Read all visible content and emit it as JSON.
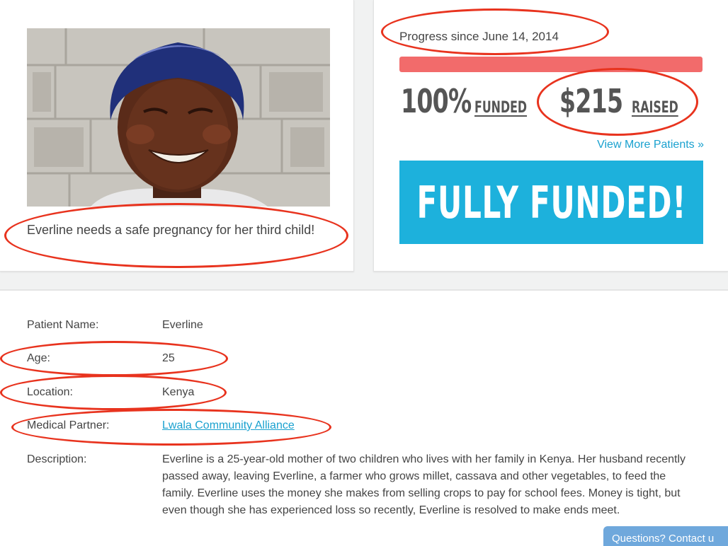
{
  "patient_card": {
    "headline": "Everline needs a safe pregnancy for her third child!"
  },
  "progress": {
    "since_label": "Progress since June 14, 2014",
    "fraction_funded": 1.0,
    "percent": "100%",
    "funded_label": "FUNDED",
    "raised_amount": "$215",
    "raised_label": "RAISED",
    "view_more": "View More Patients  »",
    "status_button": "FULLY FUNDED!",
    "bar_color": "#f26b6b",
    "button_color": "#1db1dc"
  },
  "details": {
    "rows": [
      {
        "label": "Patient Name:",
        "value": "Everline"
      },
      {
        "label": "Age:",
        "value": "25"
      },
      {
        "label": "Location:",
        "value": "Kenya"
      },
      {
        "label": "Medical Partner:",
        "value": "Lwala Community Alliance"
      },
      {
        "label": "Description:"
      }
    ],
    "description": "Everline is a 25-year-old mother of two children who lives with her family in Kenya. Her husband recently passed away, leaving Everline, a farmer who grows millet, cassava and other vegetables, to feed the family. Everline uses the money she makes from selling crops to pay for school fees. Money is tight, but even though she has experienced loss so recently, Everline is resolved to make ends meet."
  },
  "widget": {
    "questions": "Questions? Contact u"
  },
  "annotation_color": "#e8331e",
  "link_color": "#1aa1cf"
}
